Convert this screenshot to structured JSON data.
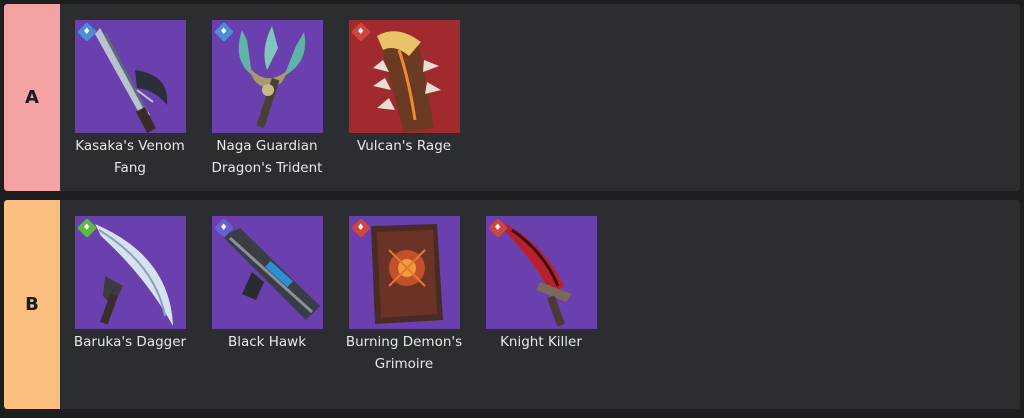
{
  "tiers": [
    {
      "label": "A",
      "color": "#f4a3a4",
      "items": [
        {
          "name": "Kasaka's Venom Fang",
          "bg": "#6b3fae",
          "element": "water-icon",
          "element_color": "#4d8cd9",
          "icon": "venom-fang-weapon-icon"
        },
        {
          "name": "Naga Guardian Dragon's Trident",
          "bg": "#6b3fae",
          "element": "water-icon",
          "element_color": "#4d8cd9",
          "icon": "trident-weapon-icon"
        },
        {
          "name": "Vulcan's Rage",
          "bg": "#a02a2e",
          "element": "fire-icon",
          "element_color": "#d1453f",
          "icon": "vulcans-rage-weapon-icon"
        }
      ]
    },
    {
      "label": "B",
      "color": "#fdbf80",
      "items": [
        {
          "name": "Baruka's Dagger",
          "bg": "#6b3fae",
          "element": "wind-icon",
          "element_color": "#5dbb3c",
          "icon": "dagger-weapon-icon"
        },
        {
          "name": "Black Hawk",
          "bg": "#6b3fae",
          "element": "dark-icon",
          "element_color": "#6a5fd0",
          "icon": "gun-weapon-icon"
        },
        {
          "name": "Burning Demon's Grimoire",
          "bg": "#6b3fae",
          "element": "fire-icon",
          "element_color": "#d1453f",
          "icon": "grimoire-weapon-icon"
        },
        {
          "name": "Knight Killer",
          "bg": "#6b3fae",
          "element": "fire-icon",
          "element_color": "#d1453f",
          "icon": "sword-weapon-icon"
        }
      ]
    }
  ]
}
